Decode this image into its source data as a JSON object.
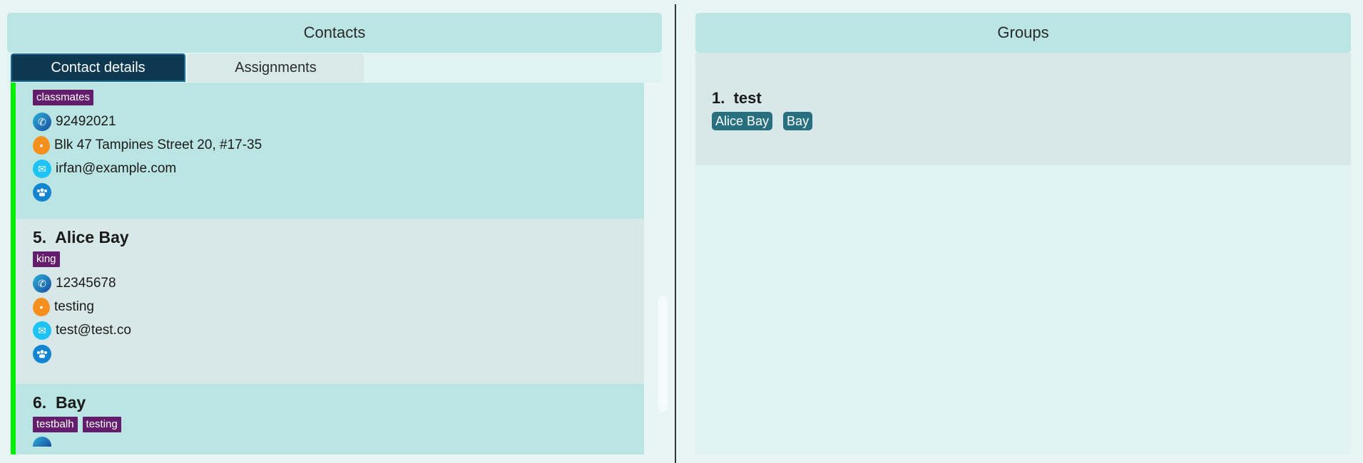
{
  "contacts_panel": {
    "title": "Contacts",
    "tabs": [
      {
        "label": "Contact details",
        "active": true
      },
      {
        "label": "Assignments",
        "active": false
      }
    ],
    "cards": [
      {
        "index": "",
        "name": "",
        "tags": [
          "classmates"
        ],
        "phone": "92492021",
        "address": "Blk 47 Tampines Street 20, #17-35",
        "email": "irfan@example.com"
      },
      {
        "index": "5.",
        "name": "Alice Bay",
        "tags": [
          "king"
        ],
        "phone": "12345678",
        "address": "testing",
        "email": "test@test.co"
      },
      {
        "index": "6.",
        "name": "Bay",
        "tags": [
          "testbalh",
          "testing"
        ]
      }
    ]
  },
  "groups_panel": {
    "title": "Groups",
    "groups": [
      {
        "index": "1.",
        "name": "test",
        "members": [
          "Alice Bay",
          "Bay"
        ]
      }
    ]
  },
  "colors": {
    "accent_bar": "#00ee00",
    "tag": "#641c6c",
    "member": "#28707f",
    "active_tab": "#0e3850"
  }
}
